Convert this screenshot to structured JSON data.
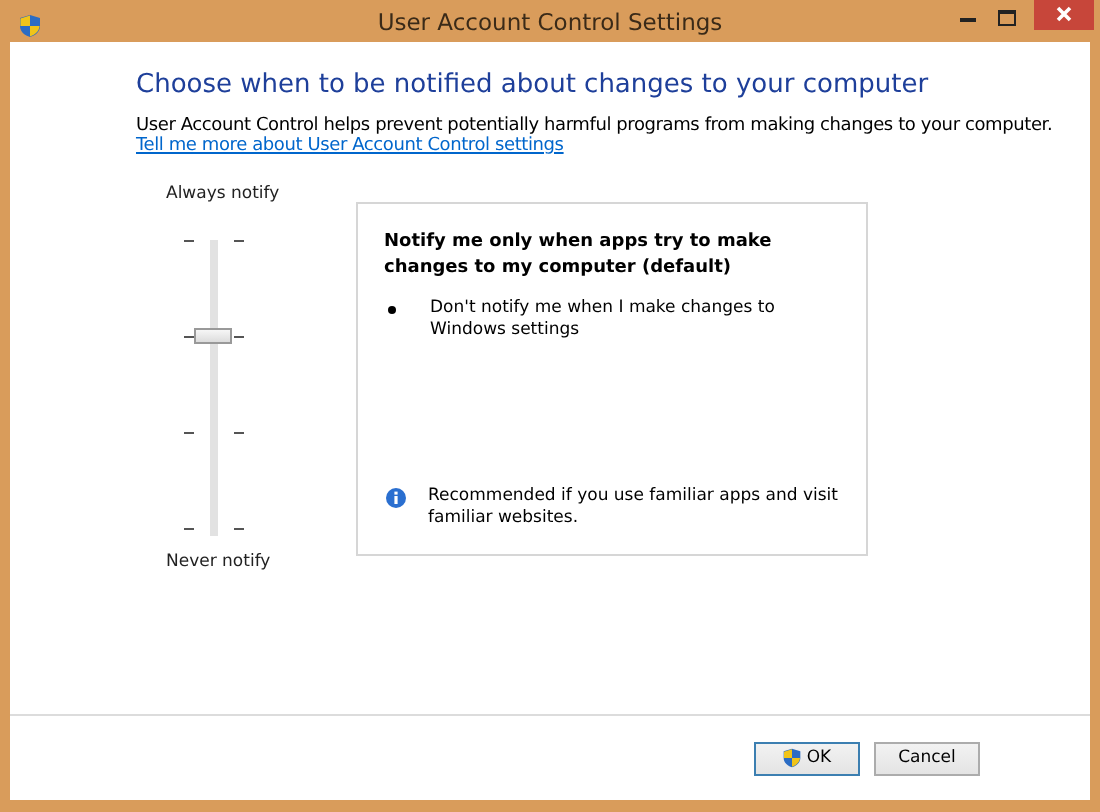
{
  "window": {
    "title": "User Account Control Settings"
  },
  "heading": "Choose when to be notified about changes to your computer",
  "description": "User Account Control helps prevent potentially harmful programs from making changes to your computer.",
  "link": "Tell me more about User Account Control settings",
  "slider": {
    "top_label": "Always notify",
    "bottom_label": "Never notify",
    "level": 0.6667
  },
  "info_panel": {
    "title": "Notify me only when apps try to make changes to my computer (default)",
    "bullets": [
      "Don't notify me when I make changes to Windows settings"
    ],
    "recommendation": "Recommended if you use familiar apps and visit familiar websites."
  },
  "buttons": [
    {
      "label": "OK",
      "kind": "shield"
    },
    {
      "label": "Cancel",
      "kind": "plain"
    }
  ]
}
